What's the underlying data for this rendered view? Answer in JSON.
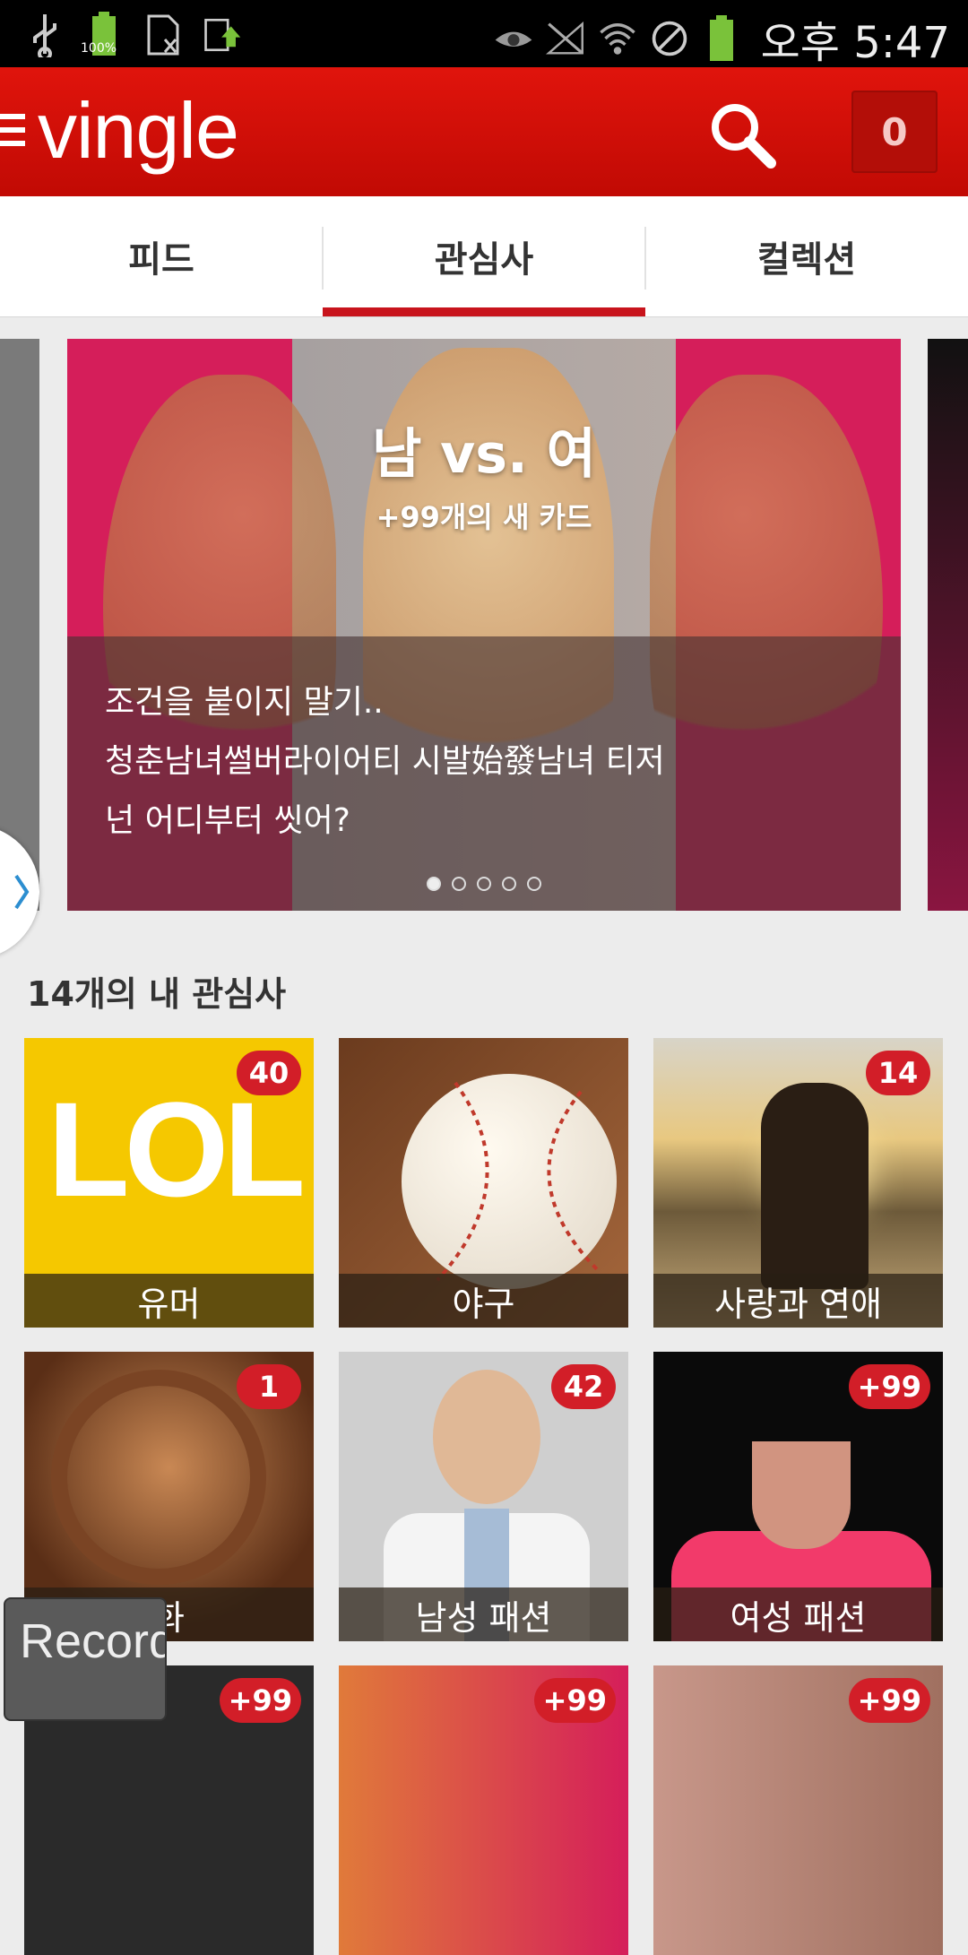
{
  "status_bar": {
    "battery_percent": "100%",
    "time": "오후 5:47"
  },
  "app": {
    "logo": "vingle",
    "cart_count": "0"
  },
  "tabs": [
    {
      "label": "피드"
    },
    {
      "label": "관심사"
    },
    {
      "label": "컬렉션"
    }
  ],
  "active_tab": 1,
  "carousel": {
    "title": "남 vs. 여",
    "subtitle": "+99개의 새 카드",
    "lines": [
      "조건을 붙이지 말기..",
      "청춘남녀썰버라이어티 시발始發남녀 티저",
      "넌 어디부터 씻어?"
    ],
    "page_count": 5,
    "active_page": 0
  },
  "section": {
    "title": "14개의 내 관심사"
  },
  "interests": [
    {
      "label": "유머",
      "badge": "40",
      "theme": "lol"
    },
    {
      "label": "야구",
      "badge": "",
      "theme": "baseball"
    },
    {
      "label": "사랑과 연애",
      "badge": "14",
      "theme": "sunset"
    },
    {
      "label": "화",
      "badge": "1",
      "theme": "film"
    },
    {
      "label": "남성 패션",
      "badge": "42",
      "theme": "man"
    },
    {
      "label": "여성 패션",
      "badge": "+99",
      "theme": "woman"
    },
    {
      "label": "",
      "badge": "+99",
      "theme": "dark"
    },
    {
      "label": "",
      "badge": "+99",
      "theme": "pink"
    },
    {
      "label": "",
      "badge": "+99",
      "theme": "skin"
    }
  ],
  "record_overlay": {
    "text": "Record"
  }
}
